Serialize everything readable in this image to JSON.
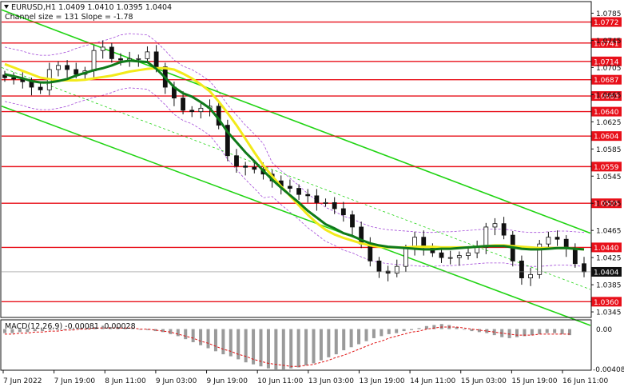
{
  "header": {
    "symbol_line": "EURUSD,H1  1.0409 1.0410 1.0395 1.0404",
    "channel_line": "Channel size = 131  Slope = -1.78"
  },
  "macd_label": "MACD(12,26,9) -0.00081 -0.00028",
  "colors": {
    "level": "#e8101a",
    "level_tag_bg": "#e8101a",
    "current_tag_bg": "#111111",
    "channel": "#22d414",
    "ma_fast": "#0f7a1a",
    "ma_slow": "#f2ea1a",
    "envelope": "#a34ad8",
    "candles": "#111111",
    "macd_hist": "#9a9a9a",
    "macd_signal": "#e01010"
  },
  "chart_data": [
    {
      "type": "line",
      "title": "EURUSD,H1",
      "price_axis_ticks": [
        "1.0785",
        "1.0745",
        "1.0705",
        "1.0665",
        "1.0625",
        "1.0585",
        "1.0545",
        "1.0505",
        "1.0465",
        "1.0425",
        "1.0385",
        "1.0345"
      ],
      "ylim": [
        1.0338,
        1.0795
      ],
      "time_axis_labels": [
        "7 Jun 2022",
        "7 Jun 19:00",
        "8 Jun 11:00",
        "9 Jun 03:00",
        "9 Jun 19:00",
        "10 Jun 11:00",
        "13 Jun 03:00",
        "13 Jun 19:00",
        "14 Jun 11:00",
        "15 Jun 03:00",
        "15 Jun 19:00",
        "16 Jun 11:00"
      ],
      "horizontal_levels": [
        "1.0772",
        "1.0741",
        "1.0714",
        "1.0687",
        "1.0663",
        "1.0640",
        "1.0604",
        "1.0559",
        "1.0505",
        "1.0440",
        "1.0360"
      ],
      "current_price": "1.0404",
      "series": [
        {
          "values": [
            1.069,
            1.0688,
            1.0684,
            1.0676,
            1.0672,
            1.0702,
            1.0708,
            1.0702,
            1.0695,
            1.07,
            1.073,
            1.0735,
            1.0718,
            1.0716,
            1.0718,
            1.0718,
            1.0728,
            1.0706,
            1.0676,
            1.066,
            1.0642,
            1.064,
            1.0645,
            1.0648,
            1.062,
            1.0575,
            1.056,
            1.0558,
            1.0555,
            1.0548,
            1.0538,
            1.053,
            1.0527,
            1.0518,
            1.0516,
            1.0506,
            1.0506,
            1.0497,
            1.0488,
            1.047,
            1.0445,
            1.042,
            1.0405,
            1.0402,
            1.0412,
            1.0438,
            1.0455,
            1.044,
            1.0432,
            1.0425,
            1.0425,
            1.0428,
            1.0432,
            1.044,
            1.047,
            1.0475,
            1.0458,
            1.042,
            1.0395,
            1.04,
            1.0445,
            1.0455,
            1.0452,
            1.0438,
            1.0416,
            1.0404
          ]
        },
        {
          "values": [
            1.0695,
            1.0692,
            1.0689,
            1.0685,
            1.0683,
            1.0683,
            1.0685,
            1.0688,
            1.0693,
            1.0697,
            1.0701,
            1.0704,
            1.0708,
            1.0713,
            1.0715,
            1.0714,
            1.0713,
            1.0703,
            1.069,
            1.0676,
            1.0667,
            1.0662,
            1.0654,
            1.0645,
            1.0629,
            1.061,
            1.0595,
            1.058,
            1.0567,
            1.0553,
            1.054,
            1.0528,
            1.0517,
            1.0506,
            1.0494,
            1.0484,
            1.0474,
            1.0468,
            1.0461,
            1.0457,
            1.0451,
            1.0446,
            1.0443,
            1.0441,
            1.044,
            1.0439,
            1.0438,
            1.0437,
            1.0437,
            1.0438,
            1.0438,
            1.0439,
            1.044,
            1.0441,
            1.0442,
            1.0442,
            1.0442,
            1.044,
            1.0438,
            1.0437,
            1.0437,
            1.0438,
            1.0439,
            1.0439,
            1.0438,
            1.0437
          ]
        },
        {
          "values": [
            1.071,
            1.0705,
            1.07,
            1.0695,
            1.069,
            1.0688,
            1.0686,
            1.0686,
            1.0686,
            1.0687,
            1.0689,
            1.0691,
            1.0693,
            1.0696,
            1.0699,
            1.0701,
            1.0703,
            1.0704,
            1.0704,
            1.0702,
            1.0696,
            1.0689,
            1.068,
            1.067,
            1.0655,
            1.0638,
            1.062,
            1.06,
            1.058,
            1.0561,
            1.0545,
            1.053,
            1.0516,
            1.0502,
            1.0488,
            1.0476,
            1.0466,
            1.0459,
            1.0454,
            1.045,
            1.0446,
            1.0443,
            1.0441,
            1.044,
            1.044,
            1.044,
            1.0441,
            1.0441,
            1.0441,
            1.044,
            1.044,
            1.044,
            1.044,
            1.0441,
            1.0442,
            1.0443,
            1.0443,
            1.0442,
            1.0441,
            1.044,
            1.0439,
            1.0439,
            1.0439,
            1.0439,
            1.0438,
            1.0437
          ]
        }
      ]
    },
    {
      "type": "bar",
      "title": "MACD(12,26,9)",
      "price_axis_ticks": [
        "0.00",
        "-0.00408"
      ],
      "ylim": [
        -0.00408,
        0.0006
      ],
      "series": [
        {
          "values": [
            -0.0004,
            -0.0004,
            -0.0003,
            -0.0003,
            -0.0002,
            -0.0002,
            -0.0001,
            -0.0001,
            -0.0001,
            0.0,
            0.0001,
            0.0001,
            0.0002,
            0.0002,
            0.0002,
            0.0002,
            0.0001,
            0.0001,
            0.0,
            -0.0001,
            -0.0002,
            -0.0003,
            -0.0005,
            -0.0007,
            -0.001,
            -0.0013,
            -0.0016,
            -0.0019,
            -0.0022,
            -0.0025,
            -0.0027,
            -0.003,
            -0.0033,
            -0.0035,
            -0.0037,
            -0.0039,
            -0.004,
            -0.004,
            -0.0039,
            -0.0038,
            -0.0036,
            -0.0034,
            -0.0031,
            -0.0028,
            -0.0025,
            -0.0021,
            -0.0018,
            -0.0015,
            -0.0012,
            -0.0009,
            -0.0007,
            -0.0005,
            -0.0004,
            -0.0002,
            -0.0001,
            0.0001,
            0.0003,
            0.0004,
            0.0005,
            0.0004,
            0.0002,
            0.0,
            -0.0002,
            -0.0003,
            -0.0004,
            -0.0006,
            -0.0008,
            -0.0009,
            -0.0008,
            -0.0007,
            -0.0006,
            -0.0005,
            -0.0004,
            -0.0004,
            -0.0005,
            -0.0006
          ]
        },
        {
          "values": [
            -0.0005,
            -0.0005,
            -0.0004,
            -0.0004,
            -0.0003,
            -0.0003,
            -0.0002,
            -0.0002,
            -0.0001,
            -0.0001,
            0.0,
            0.0,
            0.0001,
            0.0001,
            0.0001,
            0.0001,
            0.0001,
            0.0001,
            0.0,
            0.0,
            -0.0001,
            -0.0002,
            -0.0003,
            -0.0005,
            -0.0007,
            -0.0009,
            -0.0012,
            -0.0014,
            -0.0017,
            -0.002,
            -0.0022,
            -0.0025,
            -0.0027,
            -0.003,
            -0.0032,
            -0.0034,
            -0.0035,
            -0.0036,
            -0.0037,
            -0.0037,
            -0.0036,
            -0.0035,
            -0.0033,
            -0.0031,
            -0.0028,
            -0.0026,
            -0.0023,
            -0.002,
            -0.0017,
            -0.0014,
            -0.0012,
            -0.0009,
            -0.0007,
            -0.0005,
            -0.0003,
            -0.0002,
            0.0,
            0.0001,
            0.0002,
            0.0002,
            0.0002,
            0.0001,
            0.0,
            -0.0001,
            -0.0002,
            -0.0003,
            -0.0004,
            -0.0005,
            -0.0006,
            -0.0006,
            -0.0006,
            -0.0005,
            -0.0005,
            -0.0005,
            -0.0005,
            -0.0005
          ]
        }
      ]
    }
  ]
}
